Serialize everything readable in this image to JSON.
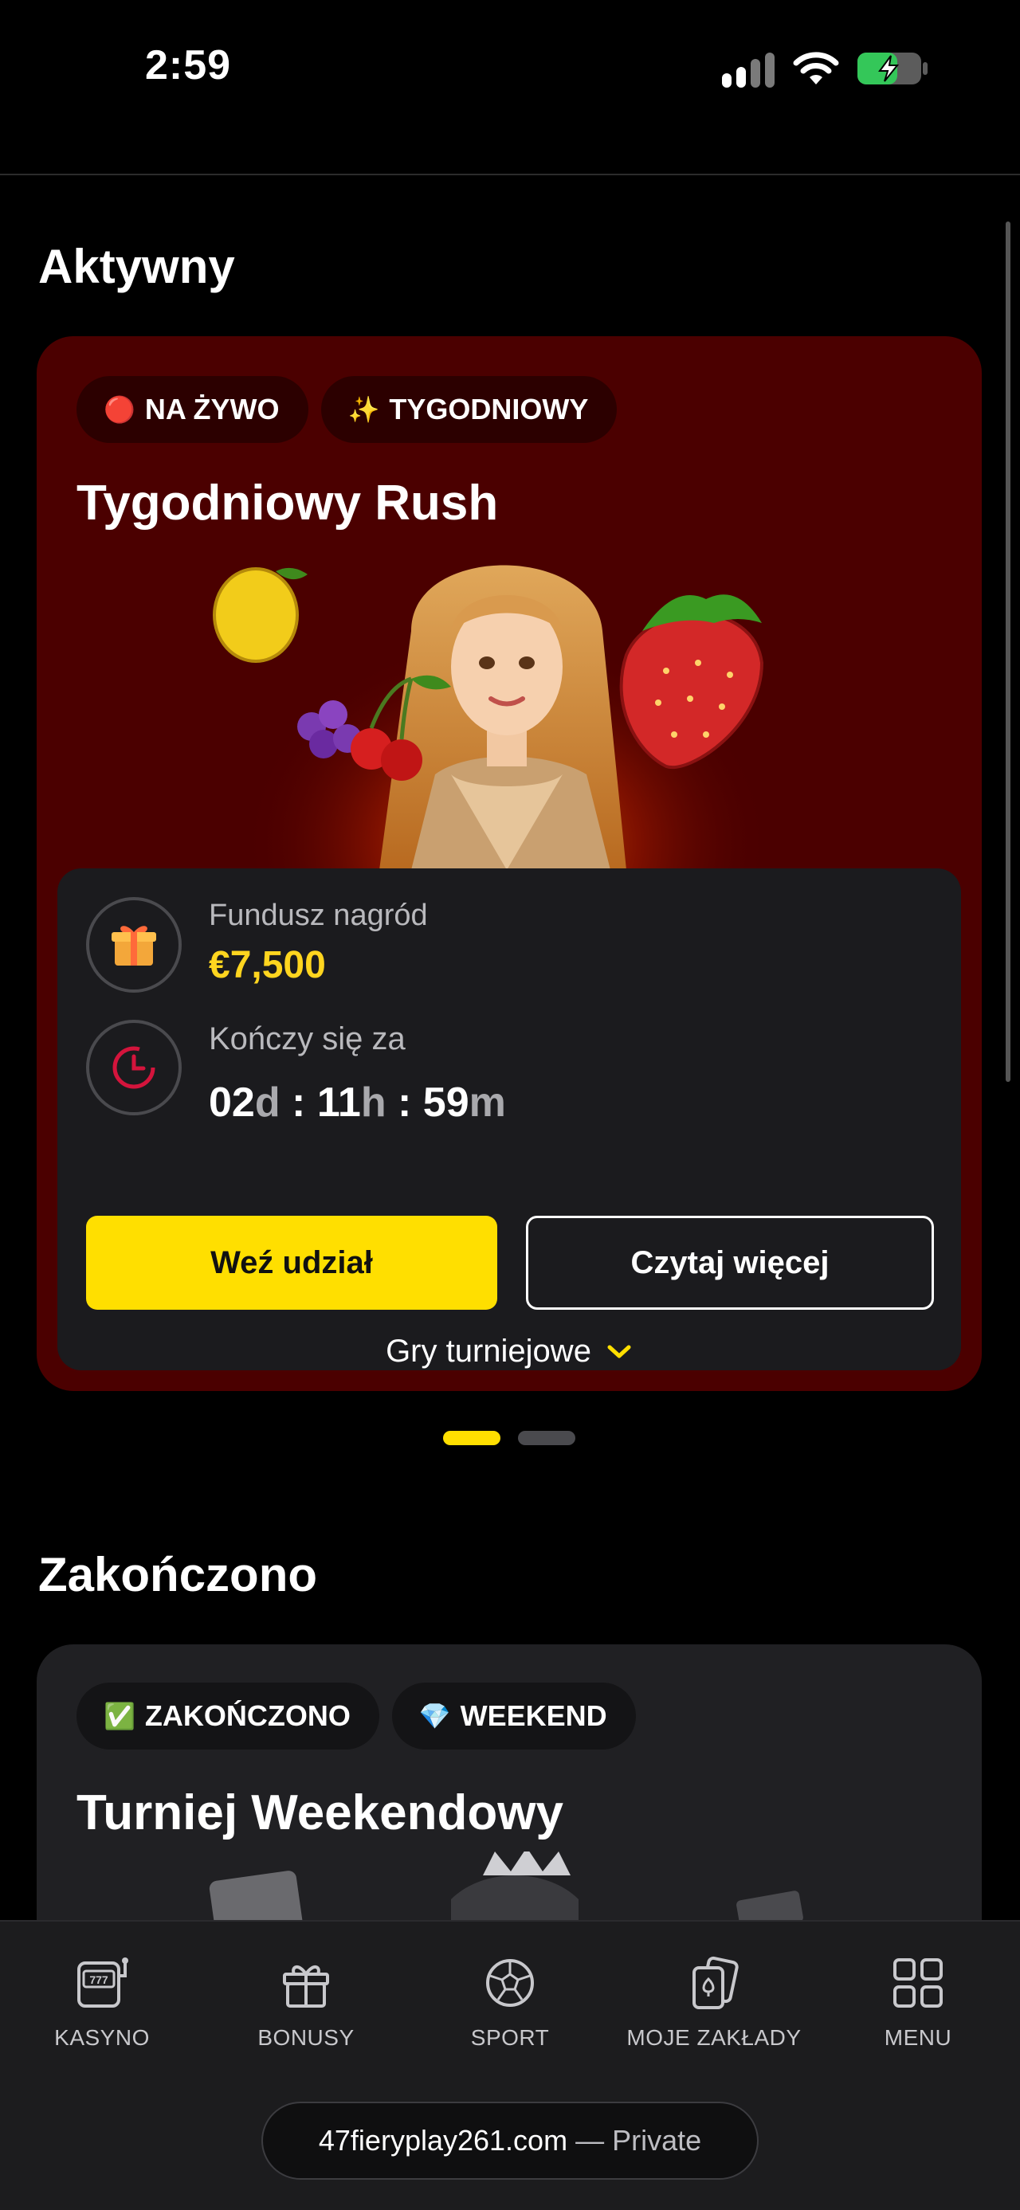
{
  "status_bar": {
    "time": "2:59"
  },
  "sections": {
    "active_title": "Aktywny",
    "ended_title": "Zakończono"
  },
  "active_card": {
    "chips": [
      {
        "emoji": "🔴",
        "label": "NA ŻYWO"
      },
      {
        "emoji": "✨",
        "label": "TYGODNIOWY"
      }
    ],
    "title": "Tygodniowy Rush",
    "prize_label": "Fundusz nagród",
    "prize_value": "€7,500",
    "ends_label": "Kończy się za",
    "countdown": {
      "days": "02",
      "days_unit": "d",
      "hours": "11",
      "hours_unit": "h",
      "minutes": "59",
      "minutes_unit": "m",
      "sep": " : "
    },
    "join_button": "Weź udział",
    "read_more_button": "Czytaj więcej",
    "games_toggle": "Gry turniejowe"
  },
  "carousel": {
    "pages": 2,
    "active_index": 0
  },
  "ended_card": {
    "chips": [
      {
        "emoji": "✅",
        "label": "ZAKOŃCZONO"
      },
      {
        "emoji": "💎",
        "label": "WEEKEND"
      }
    ],
    "title": "Turniej Weekendowy"
  },
  "bottom_nav": [
    {
      "label": "KASYNO",
      "icon": "slot-machine-icon"
    },
    {
      "label": "BONUSY",
      "icon": "gift-icon"
    },
    {
      "label": "SPORT",
      "icon": "football-icon"
    },
    {
      "label": "MOJE ZAKŁADY",
      "icon": "cards-icon"
    },
    {
      "label": "MENU",
      "icon": "grid-icon"
    }
  ],
  "browser": {
    "host": "47fieryplay261.com",
    "mode": "— Private"
  },
  "colors": {
    "accent": "#ffdf00",
    "active_card_bg": "#4b0000",
    "panel_bg": "#1b1b1e",
    "prize": "#ffd51f"
  }
}
